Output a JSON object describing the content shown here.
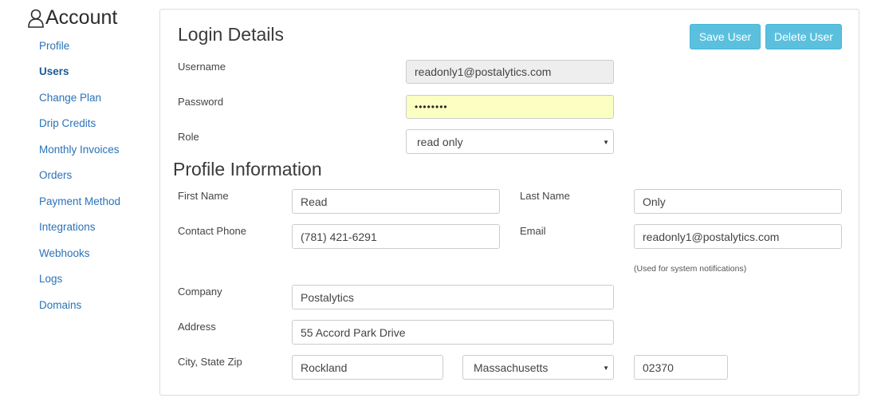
{
  "sidebar": {
    "title": "Account",
    "items": [
      {
        "label": "Profile"
      },
      {
        "label": "Users"
      },
      {
        "label": "Change Plan"
      },
      {
        "label": "Drip Credits"
      },
      {
        "label": "Monthly Invoices"
      },
      {
        "label": "Orders"
      },
      {
        "label": "Payment Method"
      },
      {
        "label": "Integrations"
      },
      {
        "label": "Webhooks"
      },
      {
        "label": "Logs"
      },
      {
        "label": "Domains"
      }
    ],
    "active": "Users"
  },
  "login": {
    "heading": "Login Details",
    "save_label": "Save User",
    "delete_label": "Delete User",
    "username_label": "Username",
    "username_value": "readonly1@postalytics.com",
    "password_label": "Password",
    "password_value": "••••••••",
    "role_label": "Role",
    "role_value": "read only"
  },
  "profile": {
    "heading": "Profile Information",
    "first_name_label": "First Name",
    "first_name_value": "Read",
    "last_name_label": "Last Name",
    "last_name_value": "Only",
    "phone_label": "Contact Phone",
    "phone_value": "(781) 421-6291",
    "email_label": "Email",
    "email_value": "readonly1@postalytics.com",
    "email_hint": "(Used for system notifications)",
    "company_label": "Company",
    "company_value": "Postalytics",
    "address_label": "Address",
    "address_value": "55 Accord Park Drive",
    "city_state_zip_label": "City, State Zip",
    "city_value": "Rockland",
    "state_value": "Massachusetts",
    "zip_value": "02370"
  },
  "colors": {
    "accent_button": "#5bc0de",
    "link": "#2a72b8",
    "password_autofill": "#fbffc2",
    "readonly_field": "#eeeeee"
  }
}
